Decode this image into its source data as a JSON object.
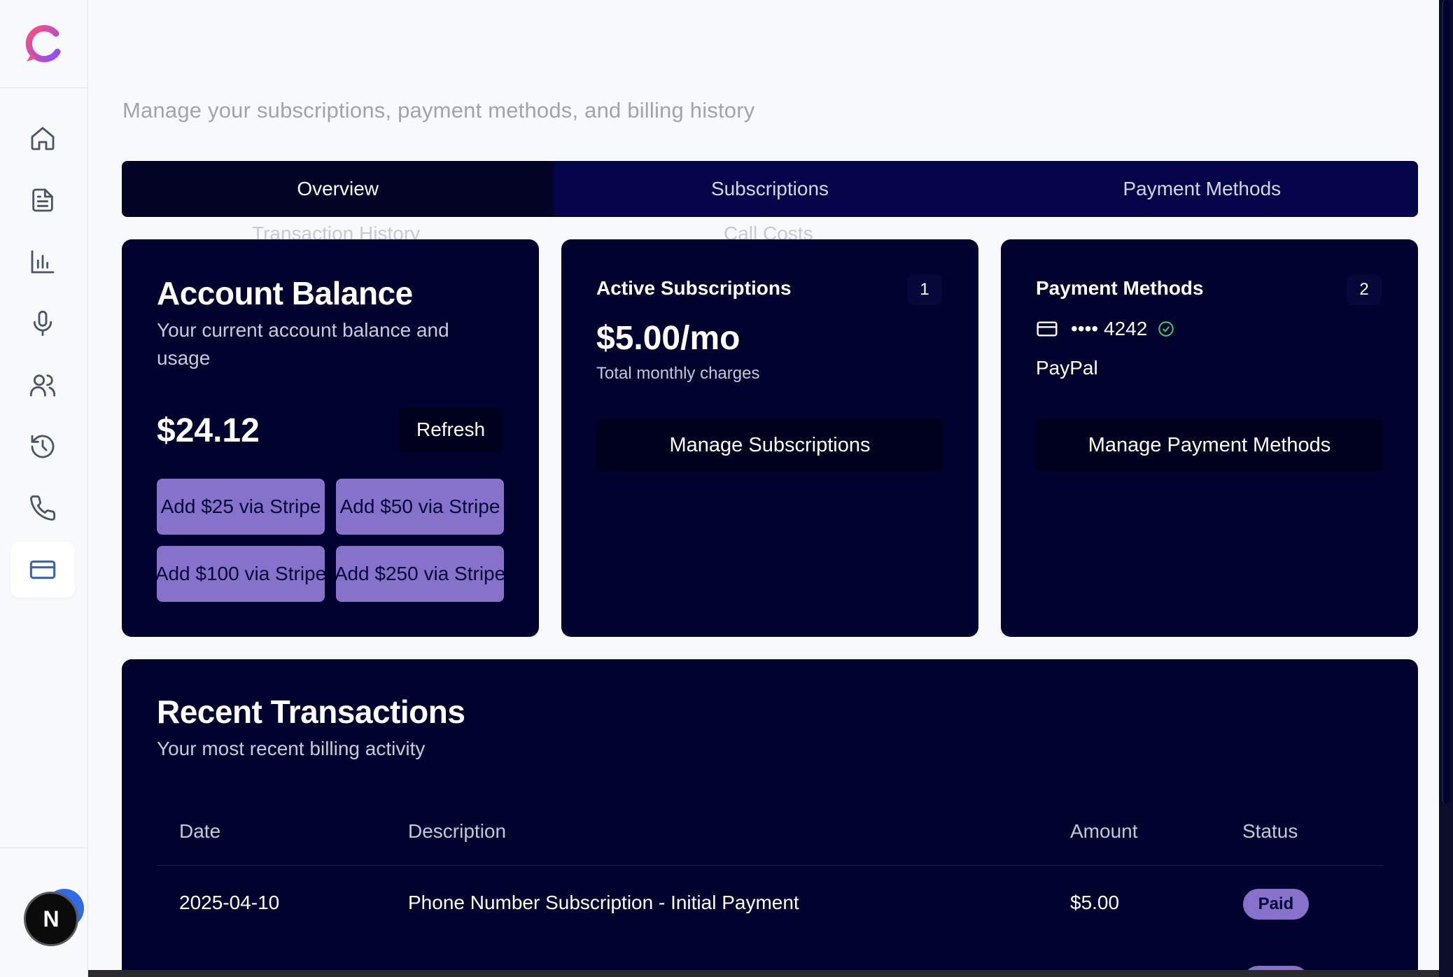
{
  "header": {
    "subtitle": "Manage your subscriptions, payment methods, and billing history"
  },
  "tabs": [
    {
      "label": "Overview",
      "active": true
    },
    {
      "label": "Subscriptions",
      "active": false
    },
    {
      "label": "Payment Methods",
      "active": false
    },
    {
      "label": "Transaction History",
      "active": false
    },
    {
      "label": "Call Costs",
      "active": false
    }
  ],
  "sidebar": {
    "items": [
      {
        "icon": "home-icon"
      },
      {
        "icon": "document-icon"
      },
      {
        "icon": "bar-chart-icon"
      },
      {
        "icon": "microphone-icon"
      },
      {
        "icon": "users-icon"
      },
      {
        "icon": "history-icon"
      },
      {
        "icon": "phone-icon"
      },
      {
        "icon": "credit-card-icon",
        "active": true
      }
    ],
    "avatar_initial": "N"
  },
  "balance_card": {
    "title": "Account Balance",
    "description": "Your current account balance and usage",
    "amount": "$24.12",
    "refresh_label": "Refresh",
    "topups": [
      "Add $25 via Stripe",
      "Add $50 via Stripe",
      "Add $100 via Stripe",
      "Add $250 via Stripe"
    ]
  },
  "subscriptions_card": {
    "title": "Active Subscriptions",
    "count": "1",
    "price": "$5.00/mo",
    "note": "Total monthly charges",
    "button_label": "Manage Subscriptions"
  },
  "payment_card": {
    "title": "Payment Methods",
    "count": "2",
    "card_mask": "•••• 4242",
    "paypal": "PayPal",
    "button_label": "Manage Payment Methods"
  },
  "transactions": {
    "title": "Recent Transactions",
    "description": "Your most recent billing activity",
    "columns": [
      "Date",
      "Description",
      "Amount",
      "Status"
    ],
    "rows": [
      {
        "date": "2025-04-10",
        "description": "Phone Number Subscription - Initial Payment",
        "amount": "$5.00",
        "status": "Paid"
      }
    ]
  },
  "colors": {
    "accent": "#8672cb",
    "card_bg": "#02022f",
    "tabs_bg": "#030548",
    "active_nav": "#2f5fd0"
  }
}
